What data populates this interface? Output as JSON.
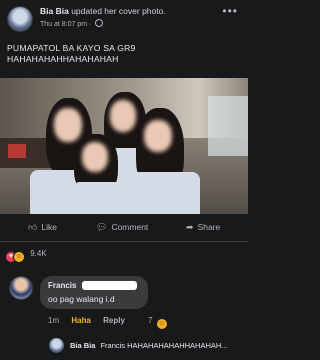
{
  "post": {
    "author": "Bia Bia",
    "action_text": "updated her cover photo.",
    "timestamp": "Thu at 8:07 pm ·",
    "more_icon": "•••",
    "caption_line1": "PUMAPATOL BA KAYO SA GR9",
    "caption_line2": "HAHAHAHAHHAHAHAHAH"
  },
  "actions": {
    "like_label": "Like",
    "comment_label": "Comment",
    "share_label": "Share"
  },
  "reactions": {
    "count": "9.4K",
    "icons": [
      "heart-icon",
      "haha-icon"
    ]
  },
  "comment": {
    "author": "Francis",
    "text": "oo pag walang i.d",
    "time": "1m",
    "haha_label": "Haha",
    "reply_label": "Reply",
    "reaction_count": "7"
  },
  "reply_preview": {
    "author": "Bia Bia",
    "text": "Francis HAHAHAHAHAHHAHAHAH..."
  },
  "colors": {
    "background": "#18191a",
    "bubble": "#3a3b3c",
    "haha_accent": "#f7b125",
    "text_primary": "#e4e6eb",
    "text_secondary": "#b0b3b8"
  }
}
